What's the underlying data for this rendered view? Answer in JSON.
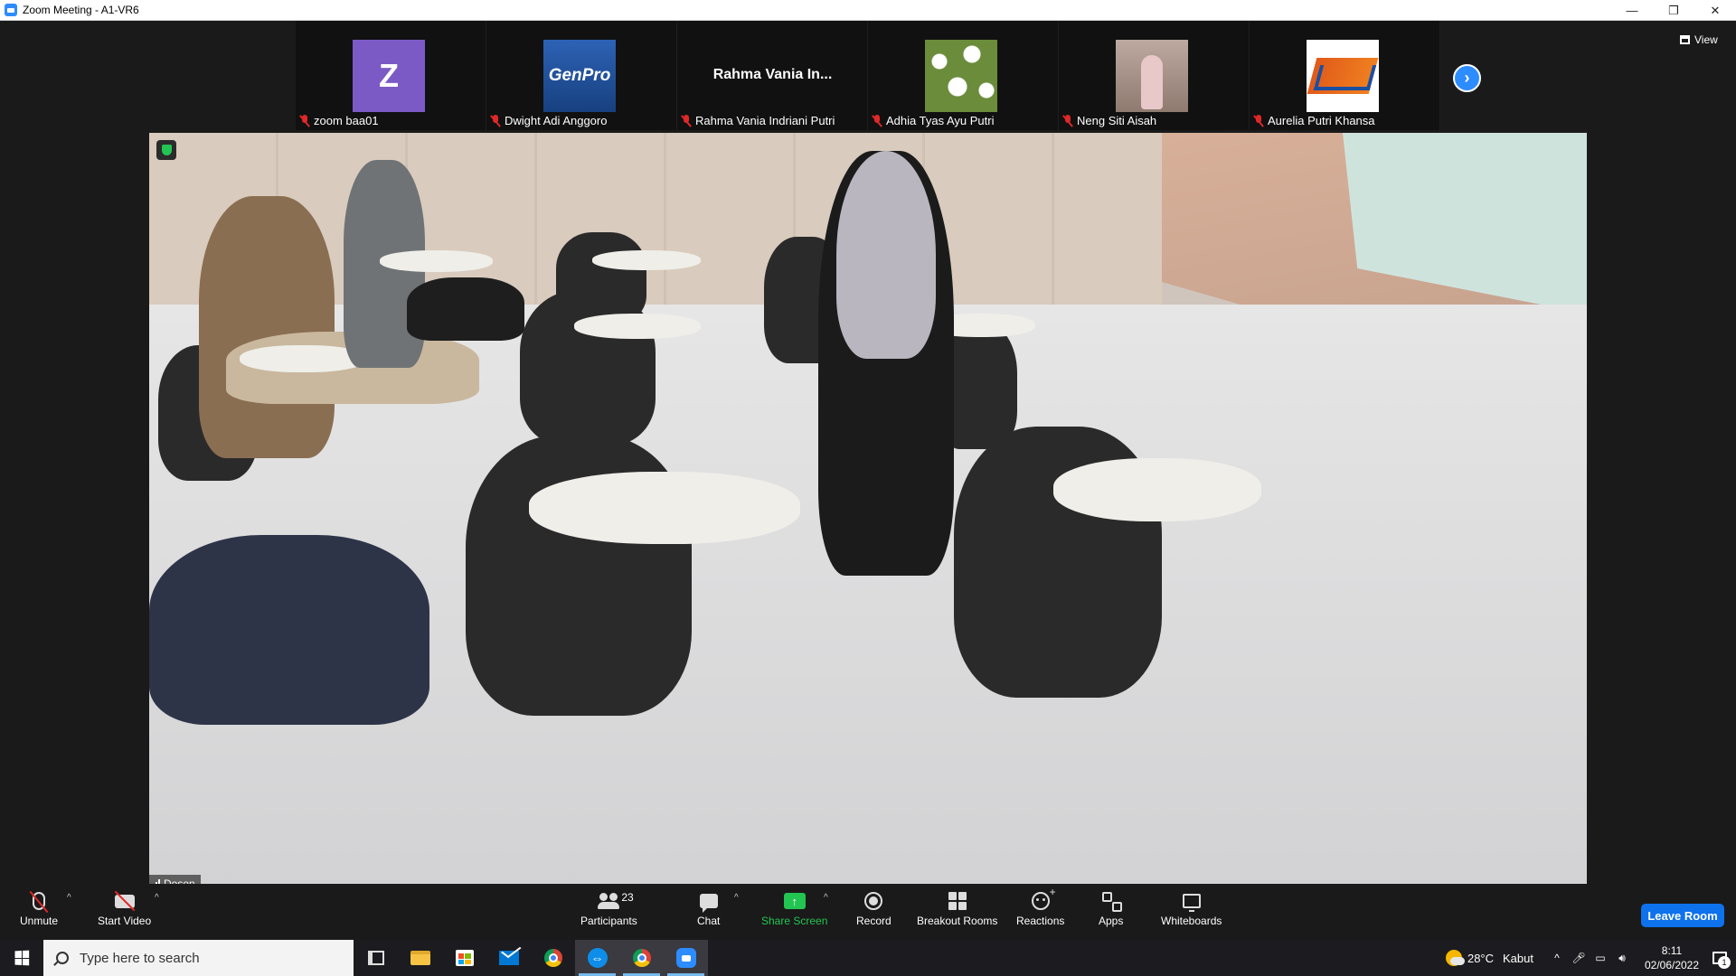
{
  "window": {
    "title": "Zoom Meeting - A1-VR6",
    "controls": {
      "minimize": "—",
      "restore": "❐",
      "close": "✕"
    }
  },
  "gallery": {
    "participants": [
      {
        "name": "zoom baa01",
        "avatar_text": "Z",
        "avatar": "letter-avatar",
        "muted": true
      },
      {
        "name": "Dwight Adi Anggoro",
        "avatar_text": "GenPro",
        "avatar": "genpro-logo",
        "muted": true
      },
      {
        "name": "Rahma Vania Indriani Putri",
        "display_text": "Rahma Vania In...",
        "avatar": "name-only",
        "muted": true
      },
      {
        "name": "Adhia Tyas Ayu Putri",
        "avatar": "daisy-photo",
        "muted": true
      },
      {
        "name": "Neng Siti Aisah",
        "avatar": "person-photo",
        "muted": true
      },
      {
        "name": "Aurelia Putri Khansa",
        "avatar": "university-logo",
        "muted": true
      }
    ],
    "next_page_icon": "chevron-right-icon",
    "view_label": "View"
  },
  "main_video": {
    "speaker_name": "Dosen",
    "security_badge": "shield-icon"
  },
  "toolbar": {
    "unmute_label": "Unmute",
    "start_video_label": "Start Video",
    "participants_label": "Participants",
    "participants_count": "23",
    "chat_label": "Chat",
    "share_screen_label": "Share Screen",
    "record_label": "Record",
    "breakout_rooms_label": "Breakout Rooms",
    "reactions_label": "Reactions",
    "apps_label": "Apps",
    "whiteboards_label": "Whiteboards",
    "leave_label": "Leave Room",
    "caret": "^"
  },
  "taskbar": {
    "search_placeholder": "Type here to search",
    "weather_temp": "28°C",
    "weather_desc": "Kabut",
    "tray_chevron": "^",
    "time": "8:11",
    "date": "02/06/2022",
    "notification_count": "1"
  },
  "colors": {
    "zoom_blue": "#2d8cff",
    "leave_blue": "#0e72ed",
    "share_green": "#23c552",
    "muted_red": "#e02828"
  }
}
